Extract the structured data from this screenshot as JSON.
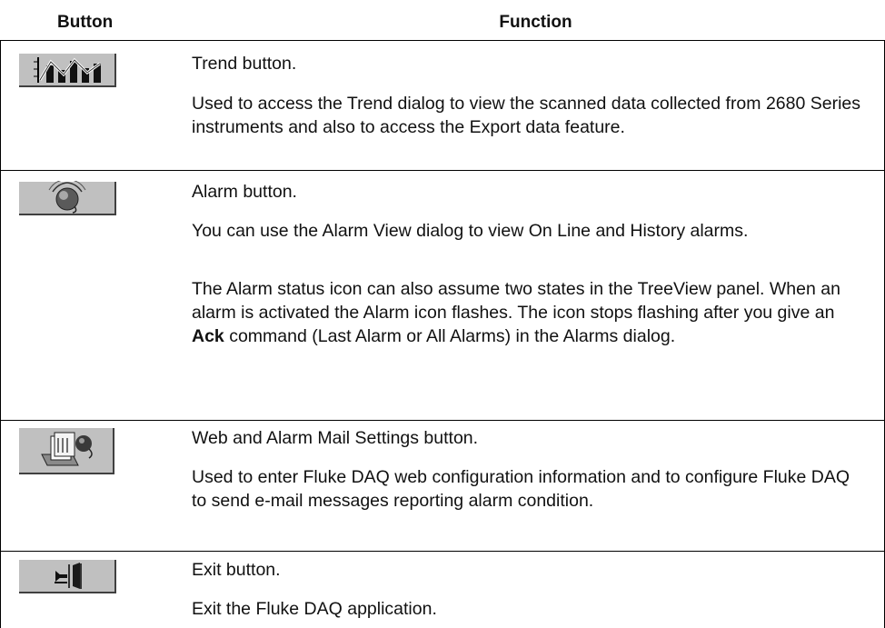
{
  "table": {
    "headers": {
      "button": "Button",
      "function": "Function"
    },
    "rows": [
      {
        "icon": "trend-chart-icon",
        "title": "Trend button.",
        "paragraphs": [
          "Used to access the Trend dialog to view the scanned data collected from 2680 Series instruments and also to access the Export data feature."
        ]
      },
      {
        "icon": "alarm-bell-icon",
        "title": "Alarm button.",
        "paragraphs": [
          "You can use the Alarm View dialog to view On Line and History alarms."
        ],
        "status": {
          "before": "The Alarm status icon can also assume two states in the TreeView panel. When an alarm is activated the Alarm icon flashes. The icon stops flashing after you give an ",
          "bold": "Ack",
          "after": " command (Last Alarm or All Alarms) in the Alarms dialog."
        }
      },
      {
        "icon": "web-mail-settings-icon",
        "title": "Web and Alarm Mail Settings button.",
        "paragraphs": [
          "Used to enter Fluke DAQ web configuration information and to configure Fluke DAQ to send e-mail messages reporting alarm condition."
        ]
      },
      {
        "icon": "exit-door-icon",
        "title": "Exit button.",
        "paragraphs": [
          "Exit the Fluke DAQ application."
        ]
      }
    ]
  }
}
